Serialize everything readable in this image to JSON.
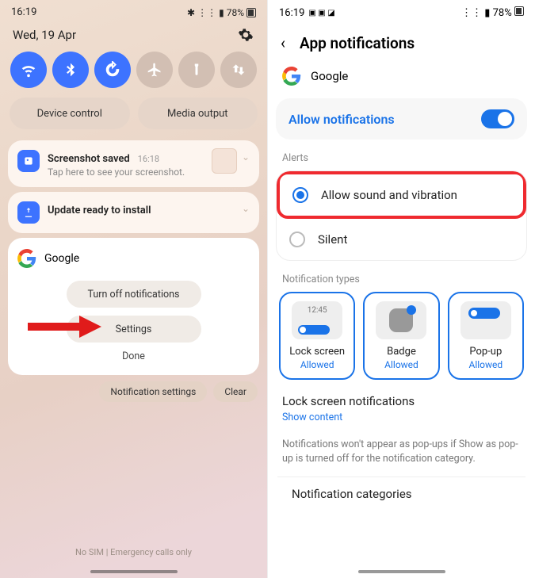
{
  "left": {
    "status": {
      "time": "16:19",
      "battery": "78%"
    },
    "date": "Wed, 19 Apr",
    "quick_toggles": [
      "wifi",
      "bluetooth",
      "rotate",
      "airplane",
      "torch",
      "transfer"
    ],
    "controls": {
      "device": "Device control",
      "media": "Media output"
    },
    "notif1": {
      "title": "Screenshot saved",
      "time": "16:18",
      "sub": "Tap here to see your screenshot."
    },
    "notif2": {
      "title": "Update ready to install"
    },
    "google": {
      "name": "Google",
      "btn_turnoff": "Turn off notifications",
      "btn_settings": "Settings",
      "btn_done": "Done"
    },
    "footer": {
      "notif_settings": "Notification settings",
      "clear": "Clear"
    },
    "nosim": "No SIM | Emergency calls only"
  },
  "right": {
    "status": {
      "time": "16:19",
      "battery": "78%"
    },
    "title": "App notifications",
    "app_name": "Google",
    "allow": "Allow notifications",
    "alerts_label": "Alerts",
    "alert_sound": "Allow sound and vibration",
    "alert_silent": "Silent",
    "types_label": "Notification types",
    "types": {
      "lock": {
        "name": "Lock screen",
        "status": "Allowed",
        "time": "12:45"
      },
      "badge": {
        "name": "Badge",
        "status": "Allowed"
      },
      "popup": {
        "name": "Pop-up",
        "status": "Allowed"
      }
    },
    "lock_screen": {
      "title": "Lock screen notifications",
      "link": "Show content"
    },
    "note": "Notifications won't appear as pop-ups if Show as pop-up is turned off for the notification category.",
    "categories": "Notification categories"
  }
}
